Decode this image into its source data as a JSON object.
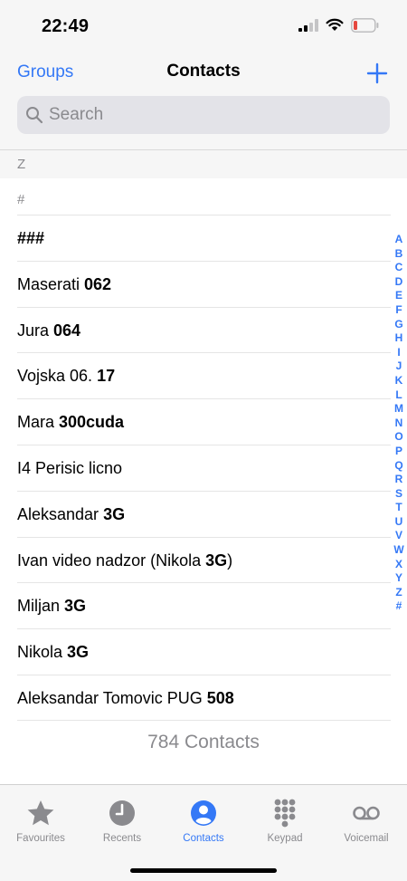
{
  "status": {
    "time": "22:49"
  },
  "nav": {
    "groups": "Groups",
    "title": "Contacts",
    "add": "+"
  },
  "search": {
    "placeholder": "Search"
  },
  "section_z": "Z",
  "section_hash": "#",
  "contacts": [
    {
      "plain": "",
      "bold": "###"
    },
    {
      "plain": "Maserati ",
      "bold": "062"
    },
    {
      "plain": "Jura ",
      "bold": "064"
    },
    {
      "plain": "Vojska 06. ",
      "bold": "17"
    },
    {
      "plain": "Mara ",
      "bold": "300cuda"
    },
    {
      "plain": "I4 Perisic licno",
      "bold": ""
    },
    {
      "plain": "Aleksandar ",
      "bold": "3G"
    },
    {
      "plain": "Ivan video nadzor (Nikola ",
      "bold": "3G",
      "suffix": ")"
    },
    {
      "plain": "Miljan ",
      "bold": "3G"
    },
    {
      "plain": "Nikola ",
      "bold": "3G"
    },
    {
      "plain": "Aleksandar Tomovic PUG ",
      "bold": "508"
    }
  ],
  "index_letters": [
    "A",
    "B",
    "C",
    "D",
    "E",
    "F",
    "G",
    "H",
    "I",
    "J",
    "K",
    "L",
    "M",
    "N",
    "O",
    "P",
    "Q",
    "R",
    "S",
    "T",
    "U",
    "V",
    "W",
    "X",
    "Y",
    "Z",
    "#"
  ],
  "contact_count": "784 Contacts",
  "tabs": [
    {
      "label": "Favourites",
      "icon": "star-icon",
      "active": false
    },
    {
      "label": "Recents",
      "icon": "clock-icon",
      "active": false
    },
    {
      "label": "Contacts",
      "icon": "person-circle-icon",
      "active": true
    },
    {
      "label": "Keypad",
      "icon": "keypad-icon",
      "active": false
    },
    {
      "label": "Voicemail",
      "icon": "voicemail-icon",
      "active": false
    }
  ],
  "colors": {
    "accent": "#3478f6",
    "inactive": "#8a8a8e",
    "battery_low": "#e5483f"
  }
}
